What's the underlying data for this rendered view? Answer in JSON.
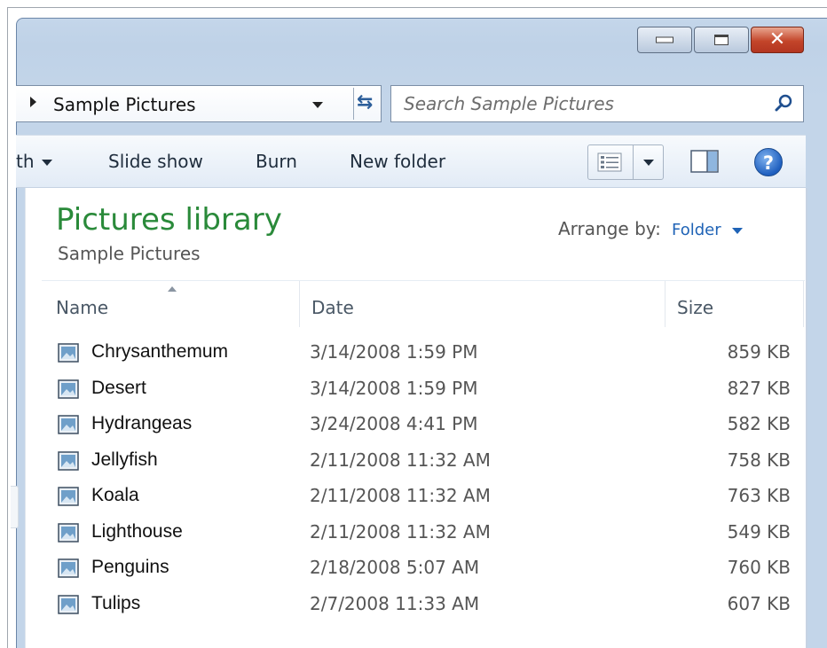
{
  "address_bar": {
    "path": "Sample Pictures"
  },
  "search": {
    "placeholder": "Search Sample Pictures"
  },
  "toolbar": {
    "share_label": "th",
    "slideshow_label": "Slide show",
    "burn_label": "Burn",
    "new_folder_label": "New folder"
  },
  "library": {
    "title": "Pictures library",
    "subtitle": "Sample Pictures",
    "arrange_label": "Arrange by:",
    "arrange_value": "Folder"
  },
  "columns": {
    "name": "Name",
    "date": "Date",
    "size": "Size"
  },
  "files": [
    {
      "name": "Chrysanthemum",
      "date": "3/14/2008 1:59 PM",
      "size": "859 KB"
    },
    {
      "name": "Desert",
      "date": "3/14/2008 1:59 PM",
      "size": "827 KB"
    },
    {
      "name": "Hydrangeas",
      "date": "3/24/2008 4:41 PM",
      "size": "582 KB"
    },
    {
      "name": "Jellyfish",
      "date": "2/11/2008 11:32 AM",
      "size": "758 KB"
    },
    {
      "name": "Koala",
      "date": "2/11/2008 11:32 AM",
      "size": "763 KB"
    },
    {
      "name": "Lighthouse",
      "date": "2/11/2008 11:32 AM",
      "size": "549 KB"
    },
    {
      "name": "Penguins",
      "date": "2/18/2008 5:07 AM",
      "size": "760 KB"
    },
    {
      "name": "Tulips",
      "date": "2/7/2008 11:33 AM",
      "size": "607 KB"
    }
  ],
  "colors": {
    "library_title": "#2a8a3a",
    "arrange_value": "#1f63b6",
    "close_button": "#c3452a"
  },
  "icons": {
    "address_arrow": "chevron-right-icon",
    "refresh": "refresh-icon",
    "search": "search-icon",
    "views": "views-icon",
    "preview_pane": "preview-pane-icon",
    "help": "help-icon",
    "file": "image-file-icon"
  }
}
